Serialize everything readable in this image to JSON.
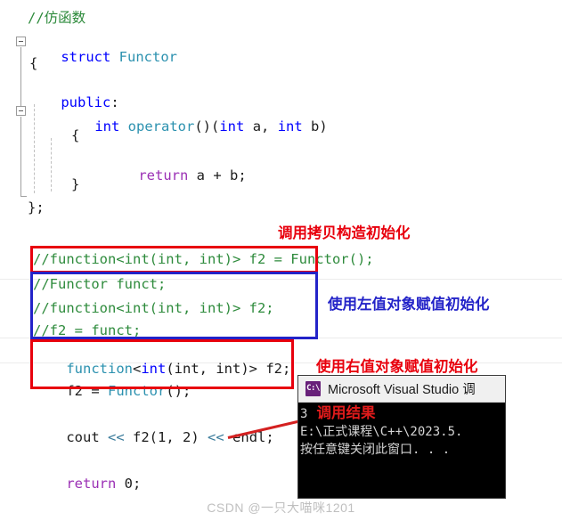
{
  "editor": {
    "code_lines": [
      {
        "id": "comment-functor",
        "text": "//仿函数"
      },
      {
        "id": "struct-decl-kw",
        "text": "struct"
      },
      {
        "id": "struct-decl-name",
        "text": "Functor"
      },
      {
        "id": "open-brace-struct",
        "text": "{"
      },
      {
        "id": "public-label",
        "text": "public"
      },
      {
        "id": "public-colon",
        "text": ":"
      },
      {
        "id": "operator-ret-type",
        "text": "int"
      },
      {
        "id": "operator-name",
        "text": "operator"
      },
      {
        "id": "operator-parens",
        "text": "()"
      },
      {
        "id": "operator-params",
        "text": "(int a, int b)"
      },
      {
        "id": "open-brace-operator",
        "text": "{"
      },
      {
        "id": "return-kw",
        "text": "return"
      },
      {
        "id": "return-expr",
        "text": "a + b;"
      },
      {
        "id": "close-brace-operator",
        "text": "}"
      },
      {
        "id": "close-brace-struct",
        "text": "};"
      }
    ],
    "line_comment_functor": "//仿函数",
    "kw_struct": "struct",
    "type_functor": "Functor",
    "brace_open": "{",
    "kw_public": "public",
    "colon": ":",
    "kw_int": "int",
    "type_operator": "operator",
    "operator_parens": "()",
    "operator_signature_params": "(",
    "param_a": "a,",
    "param_b": "b)",
    "kw_return": "return",
    "return_expr": "a + b;",
    "brace_close": "}",
    "brace_close_semi": "};",
    "commented_block": {
      "line1": "//function<int(int, int)> f2 = Functor();",
      "line2": "//Functor funct;",
      "line3": "//function<int(int, int)> f2;",
      "line4": "//f2 = funct;"
    },
    "active_block": {
      "decl_function": "function",
      "decl_open_angle": "<",
      "decl_int_outer": "int",
      "decl_params": "(int, int)",
      "decl_close_angle": ">",
      "decl_var": "f2;",
      "assign_var": "f2 = ",
      "assign_value": "Functor",
      "assign_tail": "();"
    },
    "cout_line": {
      "cout": "cout",
      "shift1": "<<",
      "call": "f2(1, 2)",
      "shift2": "<<",
      "endl": "endl;"
    },
    "return_line": {
      "kw": "return",
      "value": "0;"
    }
  },
  "annotations": {
    "copy_construct": {
      "text": "调用拷贝构造初始化",
      "color": "#e8000d"
    },
    "lvalue_assign": {
      "text": "使用左值对象赋值初始化",
      "color": "#2323c8"
    },
    "rvalue_assign": {
      "text": "使用右值对象赋值初始化",
      "color": "#e8000d"
    },
    "call_result": {
      "text": "调用结果",
      "color": "#e01b1b"
    }
  },
  "console": {
    "icon": "console-app-icon",
    "icon_glyph": "C:\\",
    "title": "Microsoft Visual Studio 调",
    "output_value": "3",
    "path_line": "E:\\正式课程\\C++\\2023.5.",
    "prompt_line": "按任意键关闭此窗口. . ."
  },
  "watermark": {
    "text": "CSDN @一只大喵咪1201"
  },
  "colors": {
    "keyword": "#0000ff",
    "type": "#2b91af",
    "comment": "#2e8b3c",
    "control": "#9b30b5",
    "operator": "#3b7c9c",
    "annotation_red": "#e8000d",
    "annotation_blue": "#2323c8",
    "console_bg": "#000000"
  }
}
